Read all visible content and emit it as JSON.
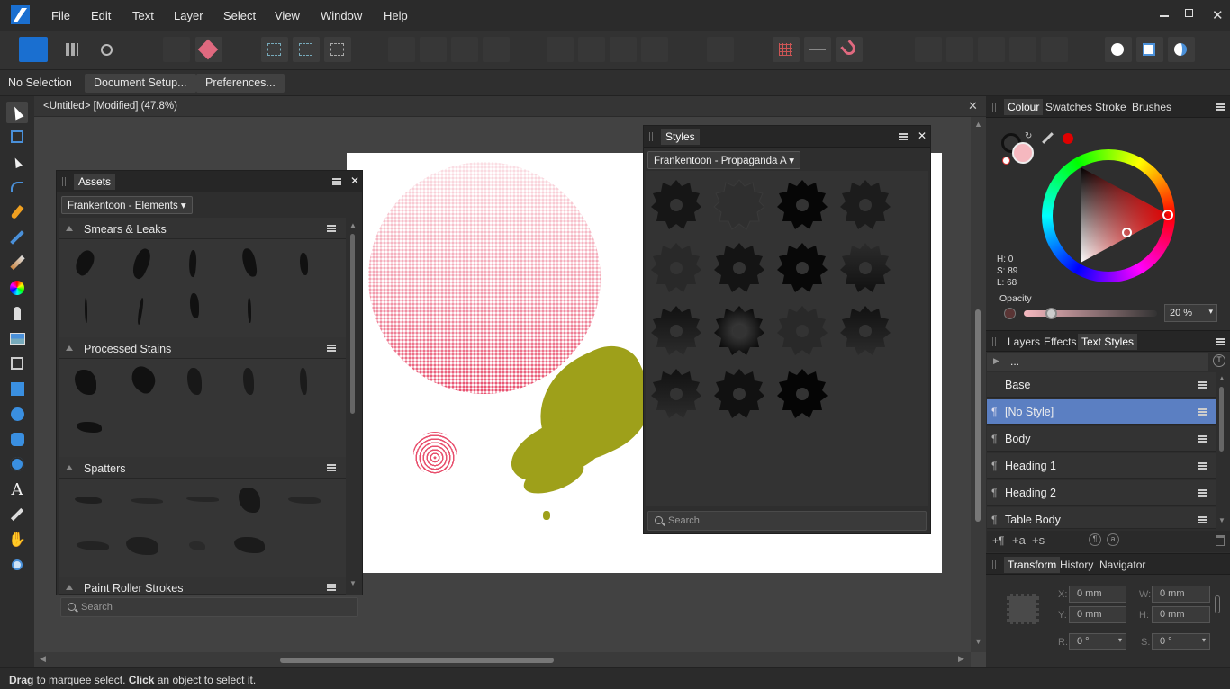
{
  "menu": [
    "File",
    "Edit",
    "Text",
    "Layer",
    "Select",
    "View",
    "Window",
    "Help"
  ],
  "context": {
    "selection": "No Selection",
    "doc_setup": "Document Setup...",
    "preferences": "Preferences..."
  },
  "document": {
    "tab_title": "<Untitled> [Modified] (47.8%)"
  },
  "assets": {
    "title": "Assets",
    "category": "Frankentoon - Elements",
    "sections": [
      "Smears & Leaks",
      "Processed Stains",
      "Spatters",
      "Paint Roller Strokes"
    ],
    "search_placeholder": "Search"
  },
  "styles": {
    "title": "Styles",
    "category": "Frankentoon - Propaganda A",
    "search_placeholder": "Search"
  },
  "colour": {
    "tabs": [
      "Colour",
      "Swatches",
      "Stroke",
      "Brushes"
    ],
    "h": "H: 0",
    "s": "S: 89",
    "l": "L: 68",
    "opacity_label": "Opacity",
    "opacity_value": "20 %",
    "opacity_fraction": 0.2
  },
  "layers": {
    "tabs": [
      "Layers",
      "Effects",
      "Text Styles"
    ],
    "path": "...",
    "rows": [
      {
        "label": "Base",
        "pilcrow": ""
      },
      {
        "label": "[No Style]",
        "pilcrow": "¶"
      },
      {
        "label": "Body",
        "pilcrow": "¶"
      },
      {
        "label": "Heading 1",
        "pilcrow": "¶"
      },
      {
        "label": "Heading 2",
        "pilcrow": "¶"
      },
      {
        "label": "Table Body",
        "pilcrow": "¶"
      }
    ]
  },
  "transform": {
    "tabs": [
      "Transform",
      "History",
      "Navigator"
    ],
    "x_label": "X:",
    "y_label": "Y:",
    "w_label": "W:",
    "h_label": "H:",
    "r_label": "R:",
    "s_label": "S:",
    "x": "0 mm",
    "y": "0 mm",
    "w": "0 mm",
    "h": "0 mm",
    "r": "0 °",
    "s": "0 °"
  },
  "status": {
    "b1": "Drag",
    "t1": " to marquee select. ",
    "b2": "Click",
    "t2": " an object to select it."
  },
  "colors": {
    "accent": "#5b7fc2",
    "pink": "#e8506e",
    "olive": "#9ea01a",
    "current_colour": "#f5b8bf"
  }
}
